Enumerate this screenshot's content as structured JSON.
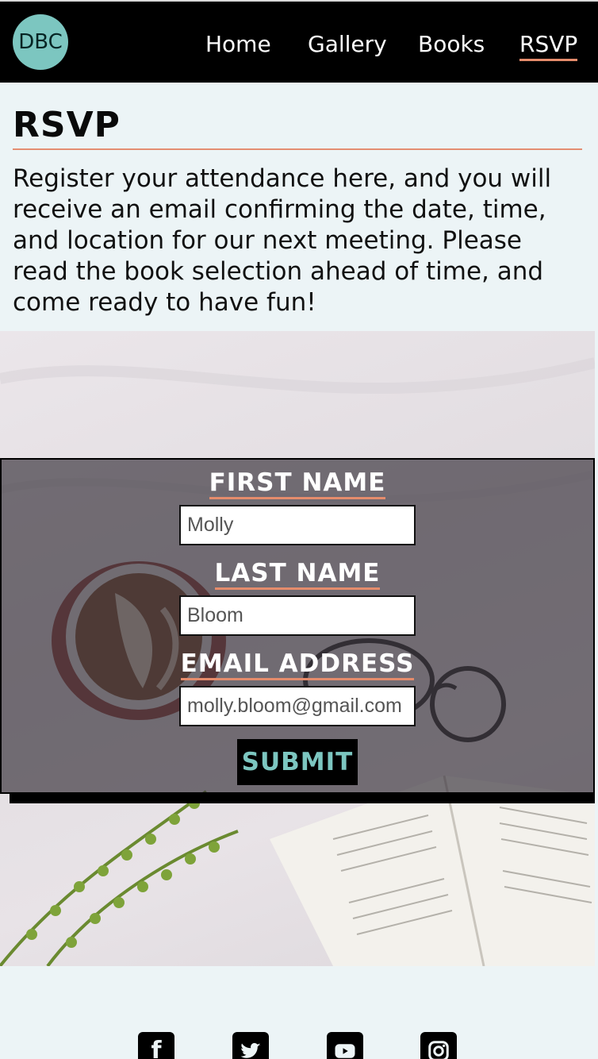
{
  "header": {
    "logo_text": "DBC",
    "nav": [
      {
        "label": "Home"
      },
      {
        "label": "Gallery"
      },
      {
        "label": "Books"
      },
      {
        "label": "RSVP",
        "active": true
      }
    ]
  },
  "intro": {
    "title": "RSVP",
    "text": "Register your attendance here, and you will receive an email confirming the date, time, and location for our next meeting. Please read the book selection ahead of time, and come ready to have fun!"
  },
  "form": {
    "first_name_label": "FIRST NAME",
    "first_name_placeholder": "Molly",
    "last_name_label": "LAST NAME",
    "last_name_placeholder": "Bloom",
    "email_label": "EMAIL ADDRESS",
    "email_placeholder": "molly.bloom@gmail.com",
    "submit_label": "SUBMIT"
  },
  "footer": {
    "social_icons": [
      "facebook-icon",
      "twitter-icon",
      "youtube-icon",
      "instagram-icon"
    ]
  },
  "colors": {
    "accent": "#e58c6c",
    "brand_teal": "#7cc6c0",
    "page_bg": "#ecf4f6",
    "header_bg": "#000000"
  }
}
